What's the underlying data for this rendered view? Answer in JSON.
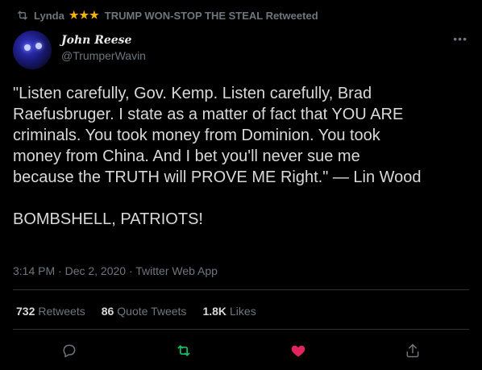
{
  "retweet_banner": {
    "user": "Lynda",
    "stars": "★★★",
    "text": "TRUMP WON-STOP THE STEAL Retweeted"
  },
  "author": {
    "display_name": "John Reese",
    "handle": "@TrumperWavin"
  },
  "tweet": {
    "lines": [
      "\"Listen carefully, Gov. Kemp. Listen carefully, Brad",
      "Raefusbruger. I state as a matter of fact that YOU ARE",
      "criminals. You took money from Dominion. You took",
      "money from China. And I bet you'll never sue me",
      "because the TRUTH will PROVE ME Right.\" — Lin Wood"
    ],
    "closing": "BOMBSHELL, PATRIOTS!"
  },
  "meta": "3:14 PM · Dec 2, 2020 · Twitter Web App",
  "stats": {
    "retweets_count": "732",
    "retweets_label": "Retweets",
    "quotes_count": "86",
    "quotes_label": "Quote Tweets",
    "likes_count": "1.8K",
    "likes_label": "Likes"
  },
  "colors": {
    "retweet_active": "#17bf63",
    "like_active": "#e0245e",
    "muted": "#6e767d"
  },
  "icons": [
    "retweet-icon",
    "more-icon",
    "reply-icon",
    "retweet-icon",
    "heart-icon",
    "share-icon"
  ]
}
